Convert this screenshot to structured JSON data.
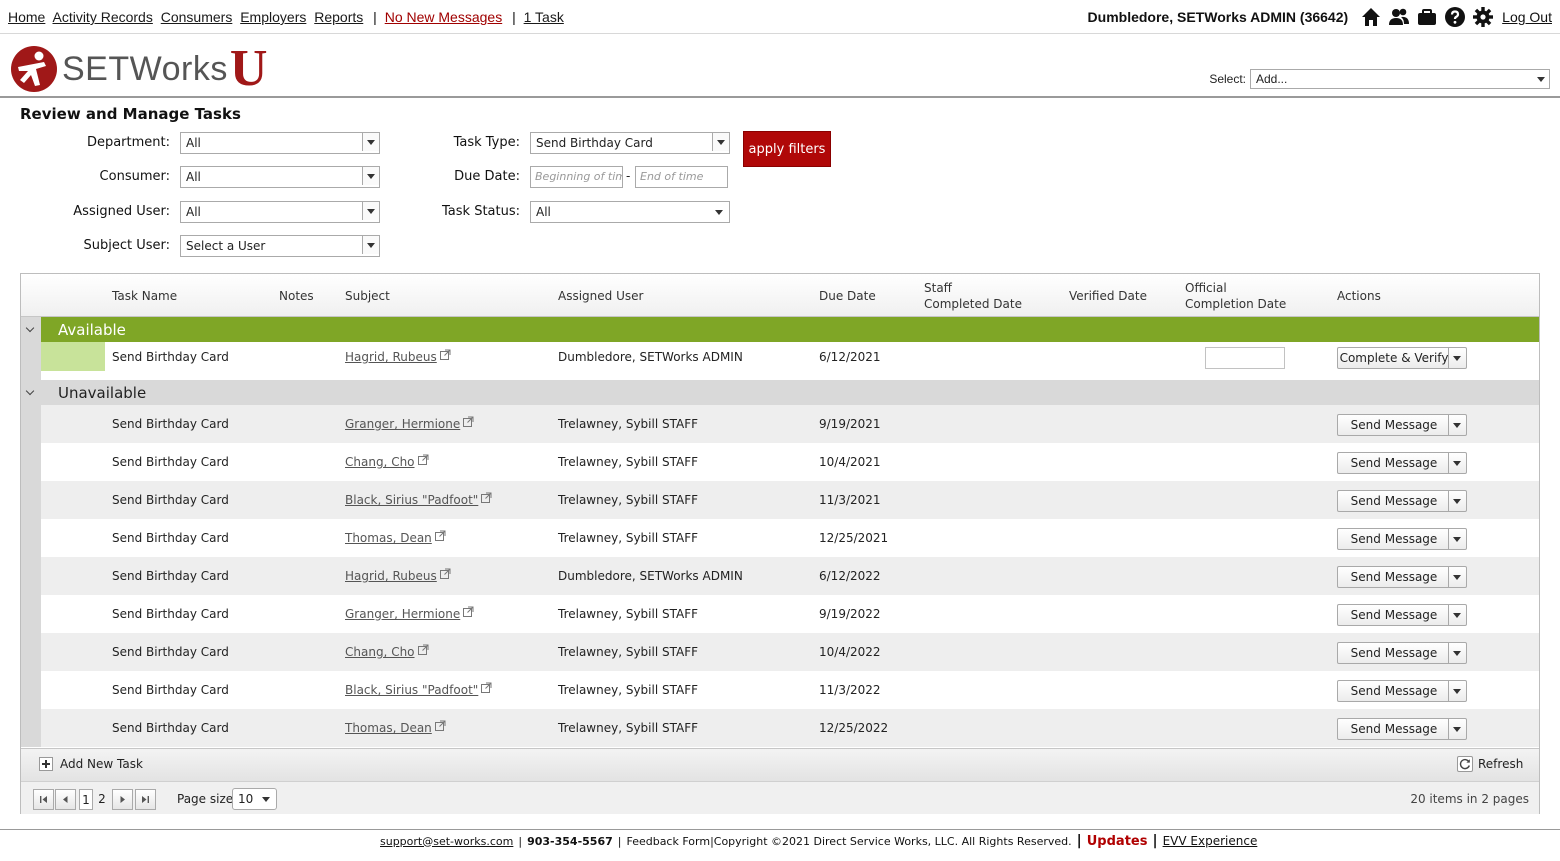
{
  "topnav": {
    "home": "Home",
    "activity": "Activity Records",
    "consumers": "Consumers",
    "employers": "Employers",
    "reports": "Reports",
    "separator": "|",
    "messages": "No New Messages",
    "tasks": "1 Task"
  },
  "user": {
    "name": "Dumbledore, SETWorks ADMIN",
    "id": "(36642)",
    "logout": "Log Out"
  },
  "logo": {
    "wordmark": "SETWorks",
    "u": "U"
  },
  "header": {
    "select_label": "Select:",
    "select_value": "Add..."
  },
  "page": {
    "title": "Review and Manage Tasks"
  },
  "filters": {
    "department_label": "Department:",
    "department_value": "All",
    "consumer_label": "Consumer:",
    "consumer_value": "All",
    "assigned_user_label": "Assigned User:",
    "assigned_user_value": "All",
    "subject_user_label": "Subject User:",
    "subject_user_value": "Select a User",
    "task_type_label": "Task Type:",
    "task_type_value": "Send Birthday Card",
    "due_date_label": "Due Date:",
    "due_date_from_placeholder": "Beginning of time",
    "due_date_dash": "-",
    "due_date_to_placeholder": "End of time",
    "task_status_label": "Task Status:",
    "task_status_value": "All",
    "apply_label": "apply filters"
  },
  "grid": {
    "headers": {
      "task_name": "Task Name",
      "notes": "Notes",
      "subject": "Subject",
      "assigned_user": "Assigned User",
      "due_date": "Due Date",
      "staff_completed_1": "Staff",
      "staff_completed_2": "Completed Date",
      "verified_date": "Verified Date",
      "official_1": "Official",
      "official_2": "Completion Date",
      "actions": "Actions"
    },
    "groups": {
      "available": "Available",
      "unavailable": "Unavailable"
    },
    "available_rows": [
      {
        "task": "Send Birthday Card",
        "subject": "Hagrid, Rubeus",
        "assigned": "Dumbledore, SETWorks ADMIN",
        "due": "6/12/2021",
        "action": "Complete & Verify"
      }
    ],
    "unavailable_rows": [
      {
        "task": "Send Birthday Card",
        "subject": "Granger, Hermione",
        "assigned": "Trelawney, Sybill STAFF",
        "due": "9/19/2021",
        "action": "Send Message"
      },
      {
        "task": "Send Birthday Card",
        "subject": "Chang, Cho",
        "assigned": "Trelawney, Sybill STAFF",
        "due": "10/4/2021",
        "action": "Send Message"
      },
      {
        "task": "Send Birthday Card",
        "subject": "Black, Sirius \"Padfoot\"",
        "assigned": "Trelawney, Sybill STAFF",
        "due": "11/3/2021",
        "action": "Send Message"
      },
      {
        "task": "Send Birthday Card",
        "subject": "Thomas, Dean",
        "assigned": "Trelawney, Sybill STAFF",
        "due": "12/25/2021",
        "action": "Send Message"
      },
      {
        "task": "Send Birthday Card",
        "subject": "Hagrid, Rubeus",
        "assigned": "Dumbledore, SETWorks ADMIN",
        "due": "6/12/2022",
        "action": "Send Message"
      },
      {
        "task": "Send Birthday Card",
        "subject": "Granger, Hermione",
        "assigned": "Trelawney, Sybill STAFF",
        "due": "9/19/2022",
        "action": "Send Message"
      },
      {
        "task": "Send Birthday Card",
        "subject": "Chang, Cho",
        "assigned": "Trelawney, Sybill STAFF",
        "due": "10/4/2022",
        "action": "Send Message"
      },
      {
        "task": "Send Birthday Card",
        "subject": "Black, Sirius \"Padfoot\"",
        "assigned": "Trelawney, Sybill STAFF",
        "due": "11/3/2022",
        "action": "Send Message"
      },
      {
        "task": "Send Birthday Card",
        "subject": "Thomas, Dean",
        "assigned": "Trelawney, Sybill STAFF",
        "due": "12/25/2022",
        "action": "Send Message"
      }
    ],
    "add_new_task": "Add New Task",
    "refresh": "Refresh"
  },
  "pager": {
    "pages": [
      "1",
      "2"
    ],
    "current_page": "1",
    "page_size_label": "Page size:",
    "page_size_value": "10",
    "items_info": "20 items in 2 pages"
  },
  "footer": {
    "email": "support@set-works.com",
    "sep1": "|",
    "phone": "903-354-5567",
    "sep2": "|",
    "feedback": "Feedback Form",
    "copyright": "|Copyright ©2021 Direct Service Works, LLC. All Rights Reserved.",
    "bar1": "|",
    "updates": "Updates",
    "bar2": "|",
    "evv": "EVV Experience"
  },
  "colors": {
    "available_group": "#7fa626",
    "available_cell": "#c8e39a",
    "unavailable_group": "#d9d9d9",
    "stripe_row": "#eeeeee",
    "apply_button": "#b00808",
    "brand_red": "#a01818",
    "messages_link": "#a00000"
  },
  "icons": [
    "home-icon",
    "users-icon",
    "briefcase-icon",
    "help-icon",
    "gear-icon",
    "external-link-icon",
    "refresh-icon",
    "plus-icon",
    "chevron-down-icon",
    "first-page-icon",
    "prev-page-icon",
    "next-page-icon",
    "last-page-icon"
  ]
}
